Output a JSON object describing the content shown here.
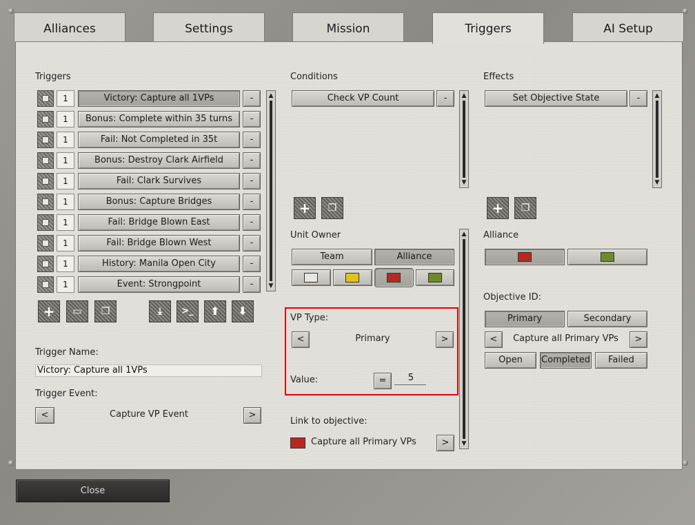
{
  "tabs": [
    "Alliances",
    "Settings",
    "Mission",
    "Triggers",
    "AI Setup"
  ],
  "active_tab": "Triggers",
  "triggers_section": {
    "label": "Triggers",
    "items": [
      {
        "count": "1",
        "label": "Victory: Capture all 1VPs",
        "remove": "-"
      },
      {
        "count": "1",
        "label": "Bonus: Complete within 35 turns",
        "remove": "-"
      },
      {
        "count": "1",
        "label": "Fail: Not Completed in 35t",
        "remove": "-"
      },
      {
        "count": "1",
        "label": "Bonus: Destroy Clark Airfield",
        "remove": "-"
      },
      {
        "count": "1",
        "label": "Fail: Clark Survives",
        "remove": "-"
      },
      {
        "count": "1",
        "label": "Bonus: Capture Bridges",
        "remove": "-"
      },
      {
        "count": "1",
        "label": "Fail: Bridge Blown East",
        "remove": "-"
      },
      {
        "count": "1",
        "label": "Fail: Bridge Blown West",
        "remove": "-"
      },
      {
        "count": "1",
        "label": "History: Manila Open City",
        "remove": "-"
      },
      {
        "count": "1",
        "label": "Event: Strongpoint",
        "remove": "-"
      }
    ]
  },
  "trigger_name": {
    "label": "Trigger Name:",
    "value": "Victory: Capture all 1VPs"
  },
  "trigger_event": {
    "label": "Trigger Event:",
    "value": "Capture VP Event",
    "prev": "<",
    "next": ">"
  },
  "conditions": {
    "label": "Conditions",
    "items": [
      {
        "label": "Check VP Count",
        "remove": "-"
      }
    ]
  },
  "unit_owner": {
    "label": "Unit Owner",
    "team": "Team",
    "alliance": "Alliance",
    "colors": [
      "#e6e6e3",
      "#e3c21a",
      "#b52a20",
      "#6f8a2a"
    ]
  },
  "vp_type": {
    "label": "VP Type:",
    "value": "Primary",
    "prev": "<",
    "next": ">"
  },
  "value": {
    "label": "Value:",
    "operator": "=",
    "amount": "5"
  },
  "link_to_objective": {
    "label": "Link to objective:",
    "value": "Capture all Primary VPs",
    "next": ">",
    "color": "#b52a20"
  },
  "effects": {
    "label": "Effects",
    "items": [
      {
        "label": "Set Objective State",
        "remove": "-"
      }
    ]
  },
  "alliance": {
    "label": "Alliance",
    "colors": [
      "#b52a20",
      "#6f8a2a"
    ]
  },
  "objective_id": {
    "label": "Objective ID:",
    "primary": "Primary",
    "secondary": "Secondary",
    "value": "Capture all Primary VPs",
    "prev": "<",
    "next": ">",
    "states": [
      "Open",
      "Completed",
      "Failed"
    ]
  },
  "close_button": "Close",
  "icons": {
    "add": "plus-icon",
    "copy": "copy-icon",
    "folder": "folder-icon",
    "import": "import-icon",
    "console": "console-icon",
    "up": "arrow-up-icon",
    "down": "arrow-down-icon"
  }
}
